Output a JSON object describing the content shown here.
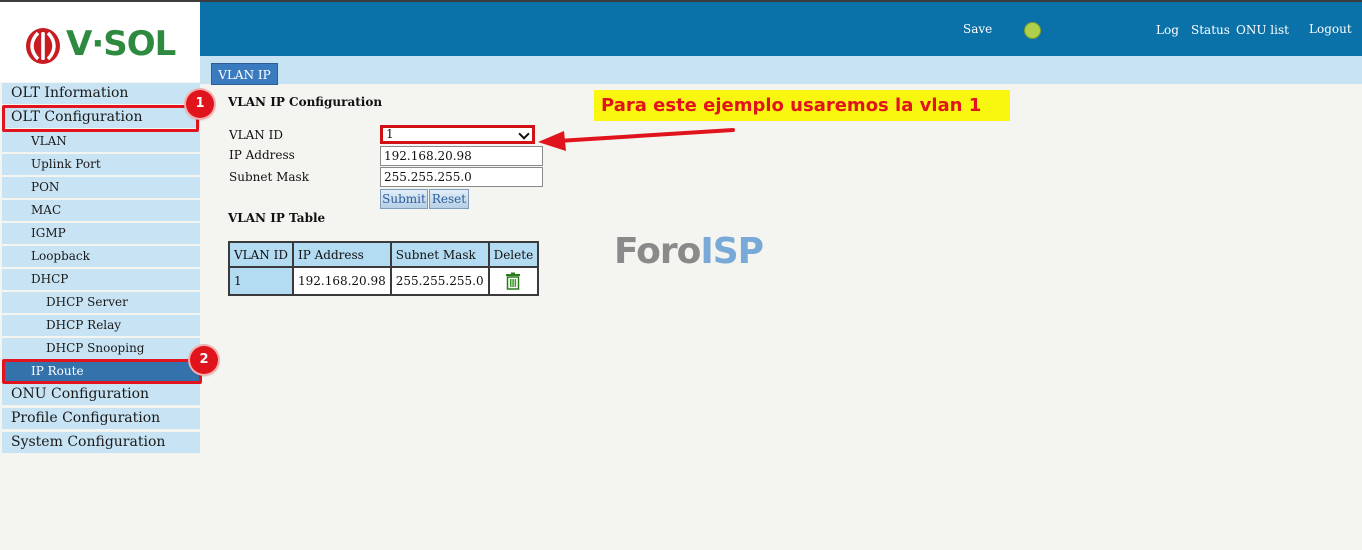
{
  "brand": {
    "logo_text": "V·SOL"
  },
  "header": {
    "links": [
      "Save",
      "Log",
      "Status",
      "ONU list",
      "Logout"
    ]
  },
  "tab": {
    "label": "VLAN IP"
  },
  "sidebar": {
    "items": [
      {
        "label": "OLT Information"
      },
      {
        "label": "OLT Configuration"
      },
      {
        "label": "VLAN"
      },
      {
        "label": "Uplink Port"
      },
      {
        "label": "PON"
      },
      {
        "label": "MAC"
      },
      {
        "label": "IGMP"
      },
      {
        "label": "Loopback"
      },
      {
        "label": "DHCP"
      },
      {
        "label": "DHCP Server"
      },
      {
        "label": "DHCP Relay"
      },
      {
        "label": "DHCP Snooping"
      },
      {
        "label": "IP Route"
      },
      {
        "label": "ONU Configuration"
      },
      {
        "label": "Profile Configuration"
      },
      {
        "label": "System Configuration"
      }
    ]
  },
  "badges": [
    "1",
    "2"
  ],
  "form": {
    "title": "VLAN IP Configuration",
    "vlan_id_label": "VLAN ID",
    "vlan_id_value": "1",
    "ip_label": "IP Address",
    "ip_value": "192.168.20.98",
    "mask_label": "Subnet Mask",
    "mask_value": "255.255.255.0",
    "submit_label": "Submit",
    "reset_label": "Reset"
  },
  "table": {
    "title": "VLAN IP Table",
    "headers": [
      "VLAN ID",
      "IP Address",
      "Subnet Mask",
      "Delete"
    ],
    "rows": [
      [
        "1",
        "192.168.20.98",
        "255.255.255.0"
      ]
    ]
  },
  "annotation": {
    "text": "Para este ejemplo usaremos la vlan 1"
  },
  "watermark": {
    "part1": "Foro",
    "part2": "ISP"
  },
  "colors": {
    "header": "#0a72a8",
    "sidebar": "#c8e3f3",
    "active": "#3372ab",
    "highlight": "#e2141d",
    "annotation_bg": "#f9f70f"
  }
}
